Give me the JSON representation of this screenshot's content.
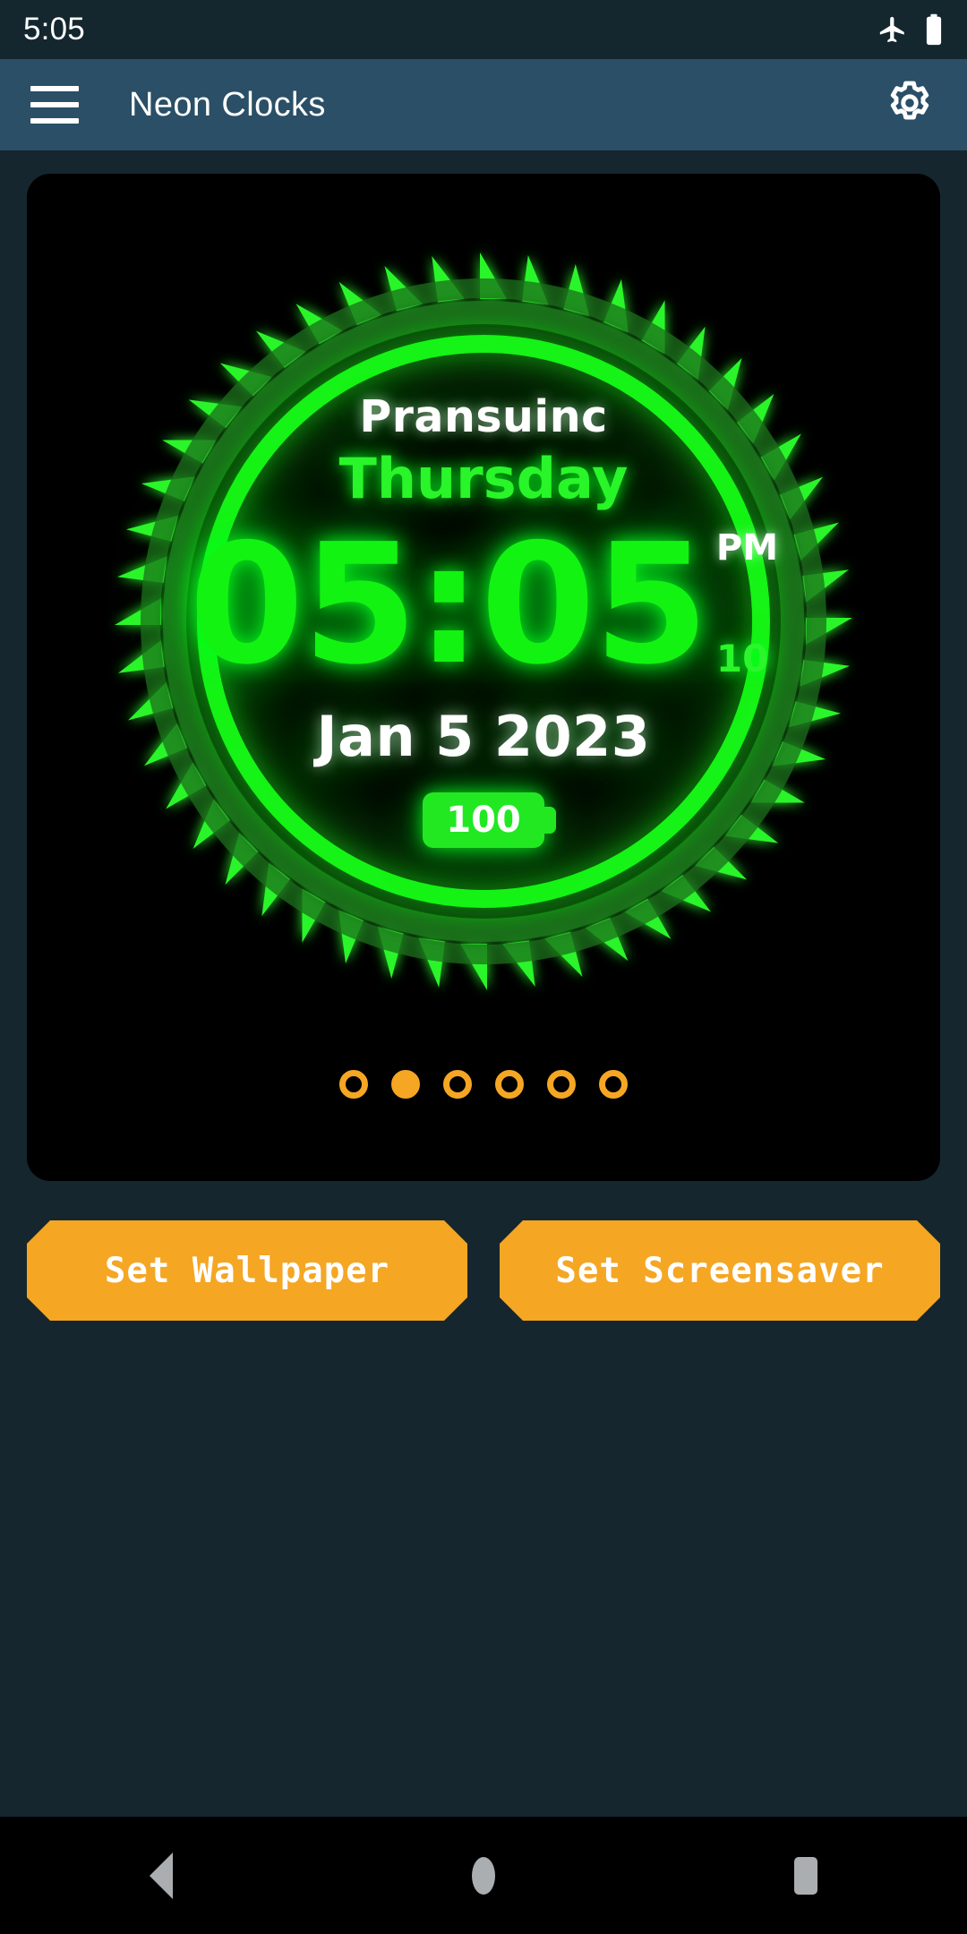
{
  "status_bar": {
    "time": "5:05",
    "icons": [
      "airplane-mode-icon",
      "battery-icon"
    ]
  },
  "app_bar": {
    "menu_icon": "hamburger-menu-icon",
    "title": "Neon Clocks",
    "settings_icon": "gear-icon"
  },
  "clock": {
    "owner_name": "Pransuinc",
    "weekday": "Thursday",
    "time": "05:05",
    "meridiem": "PM",
    "seconds": "10",
    "date": "Jan 5 2023",
    "battery_percent": "100",
    "neon_color": "#12f312",
    "ring_dim_color": "#1f7a1f",
    "spike_color": "#2bf52b",
    "face_background": "#000000"
  },
  "pager": {
    "total": 6,
    "active_index": 1,
    "dot_color": "#f5a623"
  },
  "actions": {
    "wallpaper_label": "Set Wallpaper",
    "screensaver_label": "Set Screensaver",
    "button_color": "#f5a623"
  },
  "nav_bar": {
    "back": "back-triangle-icon",
    "home": "home-circle-icon",
    "recents": "recents-square-icon"
  }
}
